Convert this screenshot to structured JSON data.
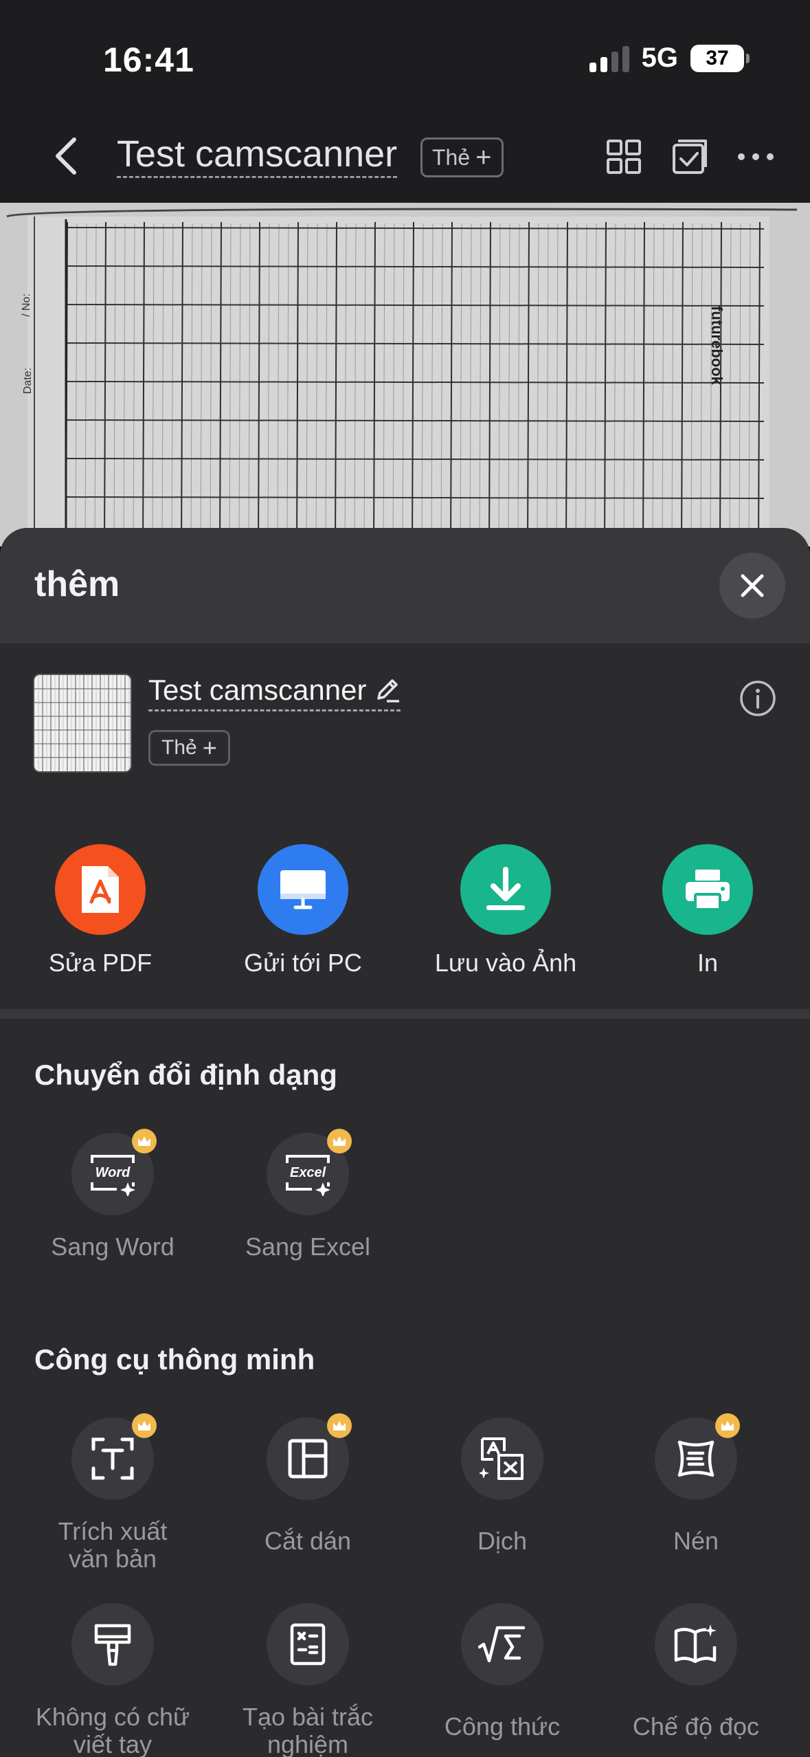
{
  "status": {
    "time": "16:41",
    "network": "5G",
    "battery": "37"
  },
  "nav": {
    "title": "Test camscanner",
    "tag": "Thẻ",
    "tag_plus": "+"
  },
  "sheet": {
    "title": "thêm",
    "file_name": "Test camscanner",
    "file_tag": "Thẻ",
    "file_tag_plus": "+"
  },
  "quick_actions": [
    {
      "label": "Sửa PDF",
      "color": "#f4511e",
      "icon": "pdf-icon"
    },
    {
      "label": "Gửi tới PC",
      "color": "#2f7cf0",
      "icon": "monitor-icon"
    },
    {
      "label": "Lưu vào Ảnh",
      "color": "#19b58c",
      "icon": "download-icon"
    },
    {
      "label": "In",
      "color": "#19b58c",
      "icon": "printer-icon"
    }
  ],
  "convert": {
    "title": "Chuyển đổi định dạng",
    "items": [
      {
        "label": "Sang Word",
        "icon_text": "Word"
      },
      {
        "label": "Sang Excel",
        "icon_text": "Excel"
      }
    ]
  },
  "tools": {
    "title": "Công cụ thông minh",
    "items": [
      {
        "label": "Trích xuất văn bản",
        "premium": true
      },
      {
        "label": "Cắt dán",
        "premium": true
      },
      {
        "label": "Dịch",
        "premium": false
      },
      {
        "label": "Nén",
        "premium": true
      },
      {
        "label": "Không có chữ viết tay",
        "premium": false
      },
      {
        "label": "Tạo bài trắc nghiệm",
        "premium": false
      },
      {
        "label": "Công thức",
        "premium": false
      },
      {
        "label": "Chế độ đọc",
        "premium": false
      }
    ]
  },
  "doc_margin_text": {
    "no": "/ No:",
    "date": "Date:",
    "brand": "futurebook"
  }
}
